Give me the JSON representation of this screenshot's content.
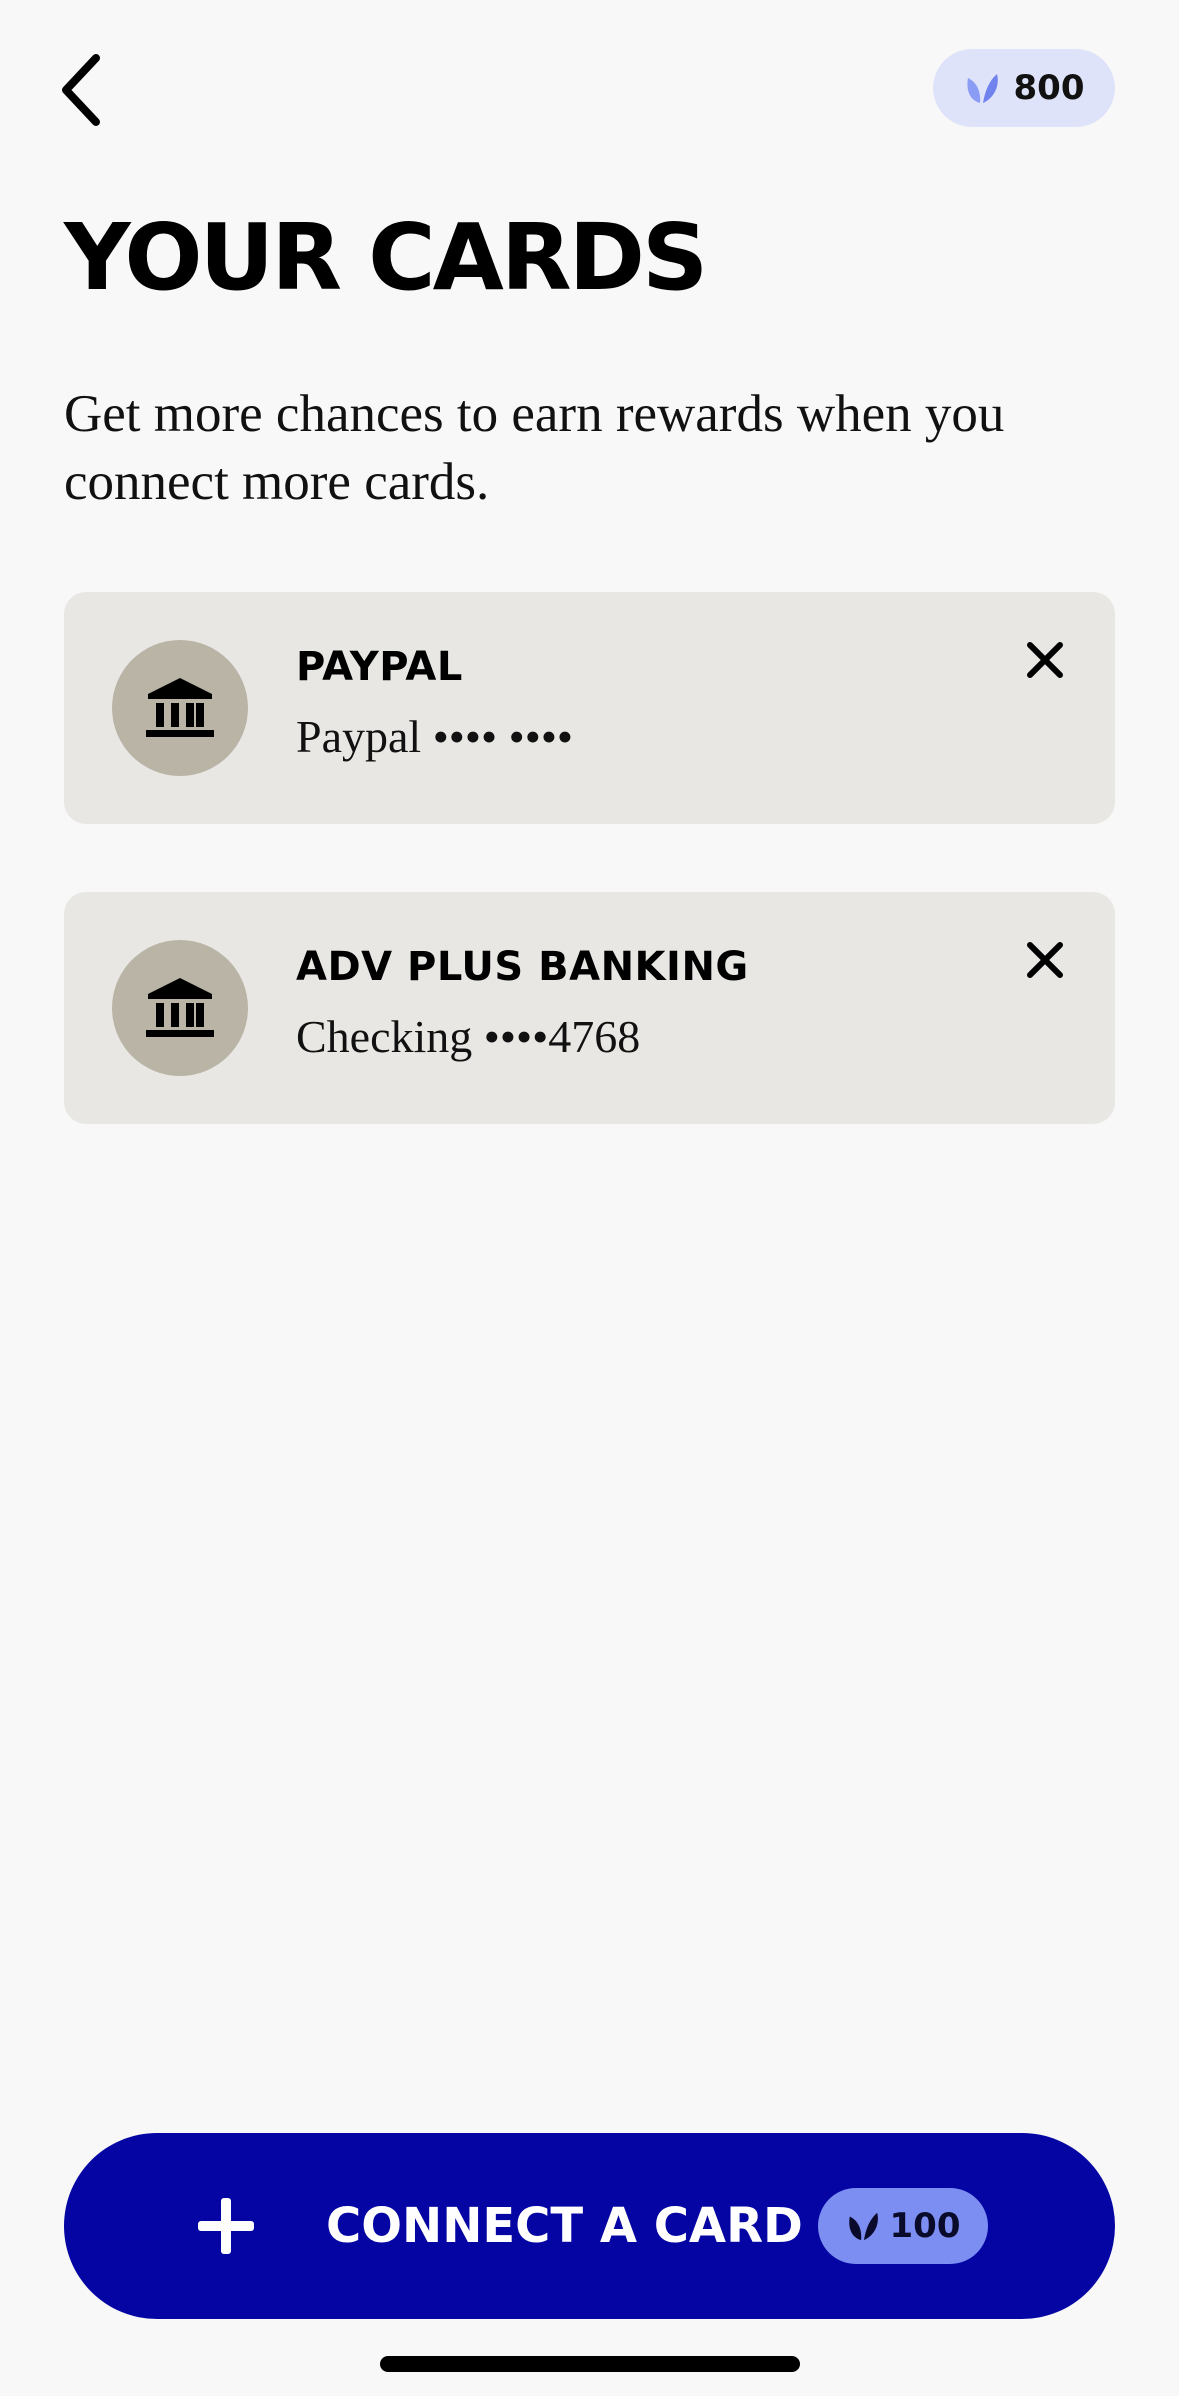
{
  "header": {
    "back_icon": "chevron-left-icon",
    "points": {
      "icon": "leaf-icon",
      "icon_color": "#8b9cf5",
      "value": "800"
    }
  },
  "page": {
    "title": "YOUR CARDS",
    "subtitle": "Get more chances to earn rewards when you connect more cards."
  },
  "cards": [
    {
      "icon": "bank-icon",
      "name": "PAYPAL",
      "detail": "Paypal •••• ••••",
      "remove_icon": "close-icon"
    },
    {
      "icon": "bank-icon",
      "name": "ADV PLUS BANKING",
      "detail": "Checking ••••4768",
      "remove_icon": "close-icon"
    }
  ],
  "connect_button": {
    "icon": "plus-icon",
    "label": "CONNECT A CARD",
    "reward": {
      "icon": "leaf-icon",
      "value": "100"
    },
    "background": "#0505a3"
  },
  "colors": {
    "background": "#f8f8f8",
    "card_background": "#e8e7e4",
    "avatar_background": "#b9b4a6",
    "points_pill": "#dfe3fa",
    "reward_pill": "#7c8ef2"
  }
}
